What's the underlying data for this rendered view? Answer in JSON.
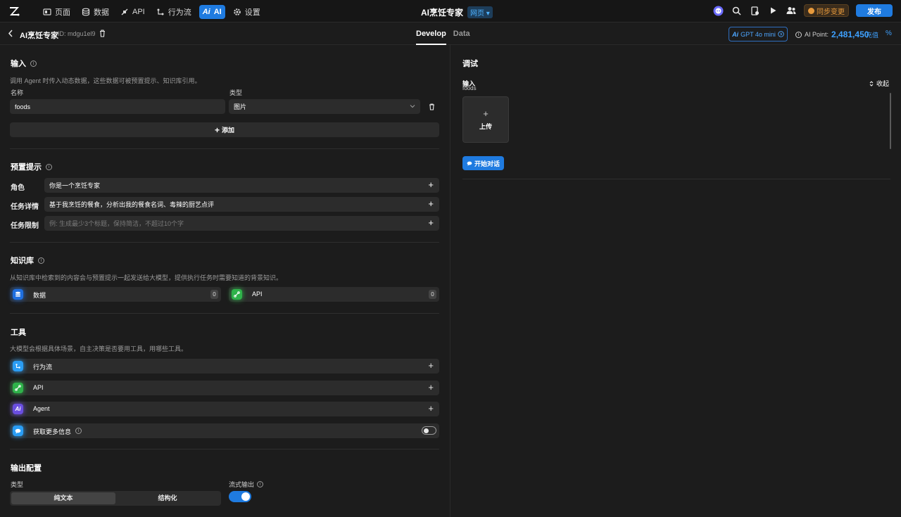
{
  "topbar": {
    "nav": [
      {
        "icon": "page-icon",
        "label": "页面"
      },
      {
        "icon": "database-icon",
        "label": "数据"
      },
      {
        "icon": "api-icon",
        "label": "API"
      },
      {
        "icon": "workflow-icon",
        "label": "行为流"
      },
      {
        "icon": "ai-icon",
        "label": "AI",
        "active": true
      },
      {
        "icon": "gear-icon",
        "label": "设置"
      }
    ],
    "app_name": "AI烹饪专家",
    "env": "网页",
    "sync_label": "同步变更",
    "publish_label": "发布"
  },
  "subbar": {
    "title": "AI烹饪专家",
    "id_text": "ID: mdgu1el9",
    "tabs": [
      "Develop",
      "Data"
    ],
    "model": "GPT 4o mini",
    "ai_point_label": "AI Point:",
    "ai_point_value": "2,481,450",
    "recharge": "充值",
    "percent": "%"
  },
  "input_section": {
    "title": "输入",
    "desc": "调用 Agent 时传入动态数据，这些数据可被预置提示、知识库引用。",
    "name_label": "名称",
    "type_label": "类型",
    "name_value": "foods",
    "type_value": "图片",
    "add_label": "添加"
  },
  "preset": {
    "title": "预置提示",
    "rows": [
      {
        "label": "角色",
        "value": "你是一个烹饪专家",
        "placeholder": false
      },
      {
        "label": "任务详情",
        "value": "基于我烹饪的餐食，分析出我的餐食名词、毒辣的厨艺点评",
        "placeholder": false
      },
      {
        "label": "任务限制",
        "value": "例: 生成最少3个标题，保持简洁，不超过10个字",
        "placeholder": true
      }
    ]
  },
  "knowledge": {
    "title": "知识库",
    "desc": "从知识库中检索到的内容会与预置提示一起发送给大模型，提供执行任务时需要知道的背景知识。",
    "items": [
      {
        "name": "数据",
        "count": "0"
      },
      {
        "name": "API",
        "count": "0"
      }
    ]
  },
  "tools": {
    "title": "工具",
    "desc": "大模型会根据具体场景，自主决策是否要用工具，用哪些工具。",
    "items": [
      {
        "name": "行为流"
      },
      {
        "name": "API"
      },
      {
        "name": "Agent"
      },
      {
        "name": "获取更多信息"
      }
    ]
  },
  "output": {
    "title": "输出配置",
    "type_label": "类型",
    "seg": [
      "纯文本",
      "结构化"
    ],
    "stream_label": "流式输出"
  },
  "debug": {
    "title": "调试",
    "input_label": "输入",
    "input_sub": "foods",
    "collapse": "收起",
    "upload": "上传",
    "chat_btn": "开始对话"
  },
  "colors": {
    "accent": "#1f7be0",
    "link": "#3ea1ff",
    "sync": "#e89a3c"
  }
}
